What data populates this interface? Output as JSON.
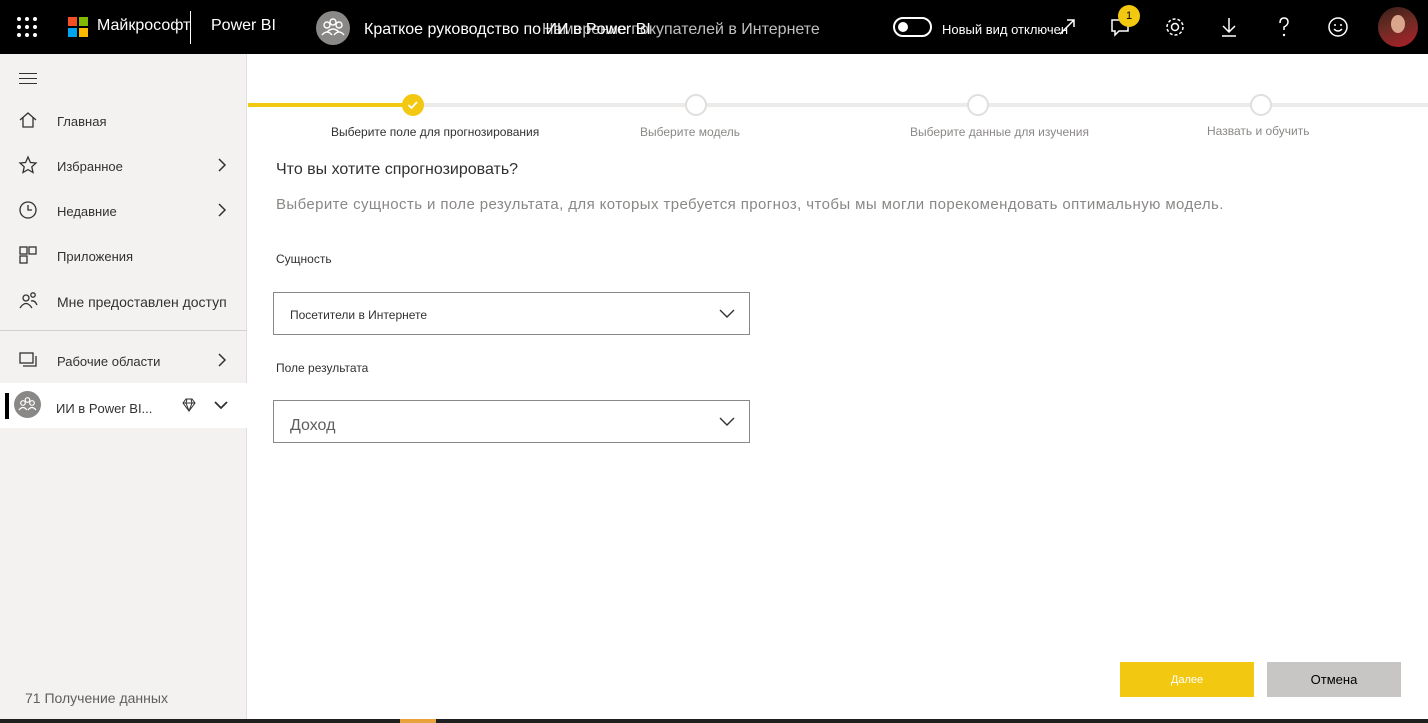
{
  "topbar": {
    "brand": "Майкрософт",
    "product": "Power BI",
    "breadcrumb": "Краткое руководство по ИИ в Power BI",
    "breadcrumb_overlay": "Намерение покупателей в Интернете",
    "toggle_label": "Новый вид отключен",
    "notification_count": "1",
    "icons": [
      "waffle-icon",
      "microsoft-logo",
      "workspace-icon",
      "expand-icon",
      "notifications-icon",
      "settings-icon",
      "download-icon",
      "help-icon",
      "feedback-icon",
      "avatar"
    ]
  },
  "sidebar": {
    "items": [
      {
        "label": "Главная",
        "icon": "home-icon"
      },
      {
        "label": "Избранное",
        "icon": "star-icon"
      },
      {
        "label": "Недавние",
        "icon": "clock-icon"
      },
      {
        "label": "Приложения",
        "icon": "apps-icon"
      },
      {
        "label": "Мне предоставлен доступ",
        "icon": "shared-icon"
      },
      {
        "label": "Рабочие области",
        "icon": "workspaces-icon"
      }
    ],
    "workspace": {
      "label": "ИИ в Power BI...",
      "icon": "workspace-icon"
    },
    "get_data": "71 Получение данных"
  },
  "wizard": {
    "steps": [
      {
        "label": "Выберите поле для прогнозирования",
        "state": "done"
      },
      {
        "label": "Выберите модель",
        "state": "pending"
      },
      {
        "label": "Выберите данные для изучения",
        "state": "pending"
      },
      {
        "label": "Назвать и обучить",
        "state": "pending"
      }
    ],
    "heading": "Что вы хотите спрогнозировать?",
    "description": "Выберите сущность и поле результата, для которых требуется прогноз, чтобы мы могли порекомендовать оптимальную модель.",
    "entity_label": "Сущность",
    "entity_value": "Посетители в Интернете",
    "outcome_label": "Поле результата",
    "outcome_value": "Доход",
    "next_label": "Далее",
    "cancel_label": "Отмена"
  },
  "colors": {
    "accent": "#f2c811",
    "topbar": "#000000",
    "sidebar": "#f3f2f1"
  }
}
